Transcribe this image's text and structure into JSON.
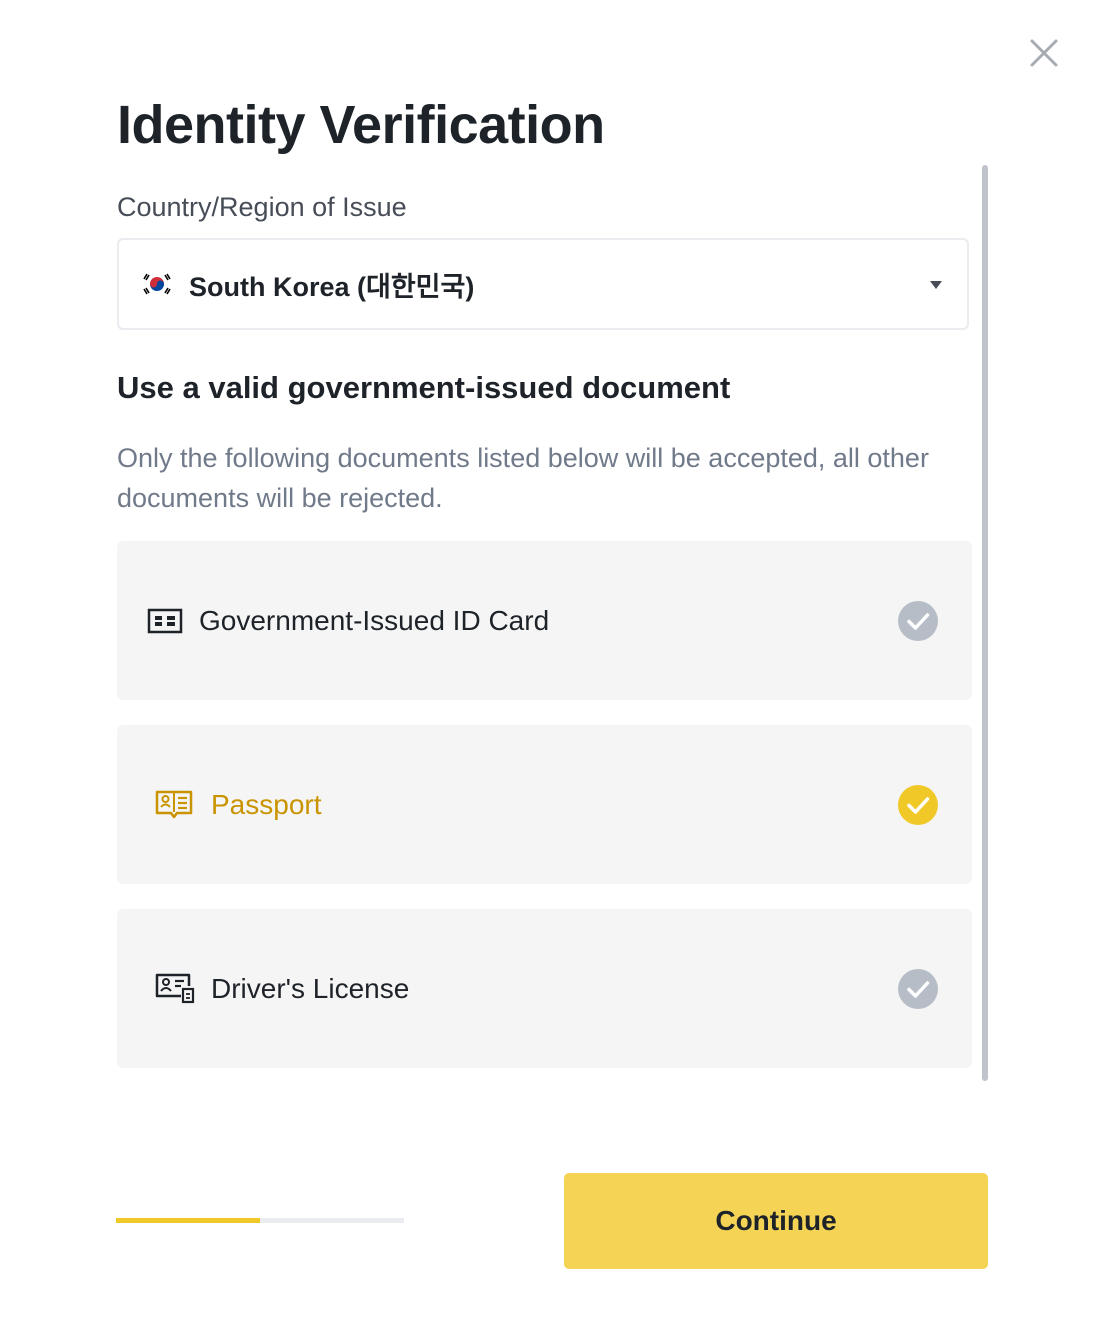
{
  "dialog": {
    "title": "Identity Verification",
    "close_icon": "close-icon"
  },
  "country": {
    "label": "Country/Region of Issue",
    "selected": "South Korea (대한민국)",
    "flag_icon": "south-korea-flag-icon"
  },
  "documents": {
    "heading": "Use a valid government-issued document",
    "description": "Only the following documents listed below will be accepted, all other documents will be rejected.",
    "options": [
      {
        "label": "Government-Issued ID Card",
        "icon": "id-card-icon",
        "selected": false
      },
      {
        "label": "Passport",
        "icon": "passport-icon",
        "selected": true
      },
      {
        "label": "Driver's License",
        "icon": "drivers-license-icon",
        "selected": false
      }
    ]
  },
  "footer": {
    "progress_fraction": 0.5,
    "continue_label": "Continue"
  },
  "colors": {
    "accent": "#f0b90b",
    "selected_text": "#c99400",
    "button": "#f5d455",
    "check_inactive": "#b7bdc6",
    "option_bg": "#f5f5f5"
  }
}
